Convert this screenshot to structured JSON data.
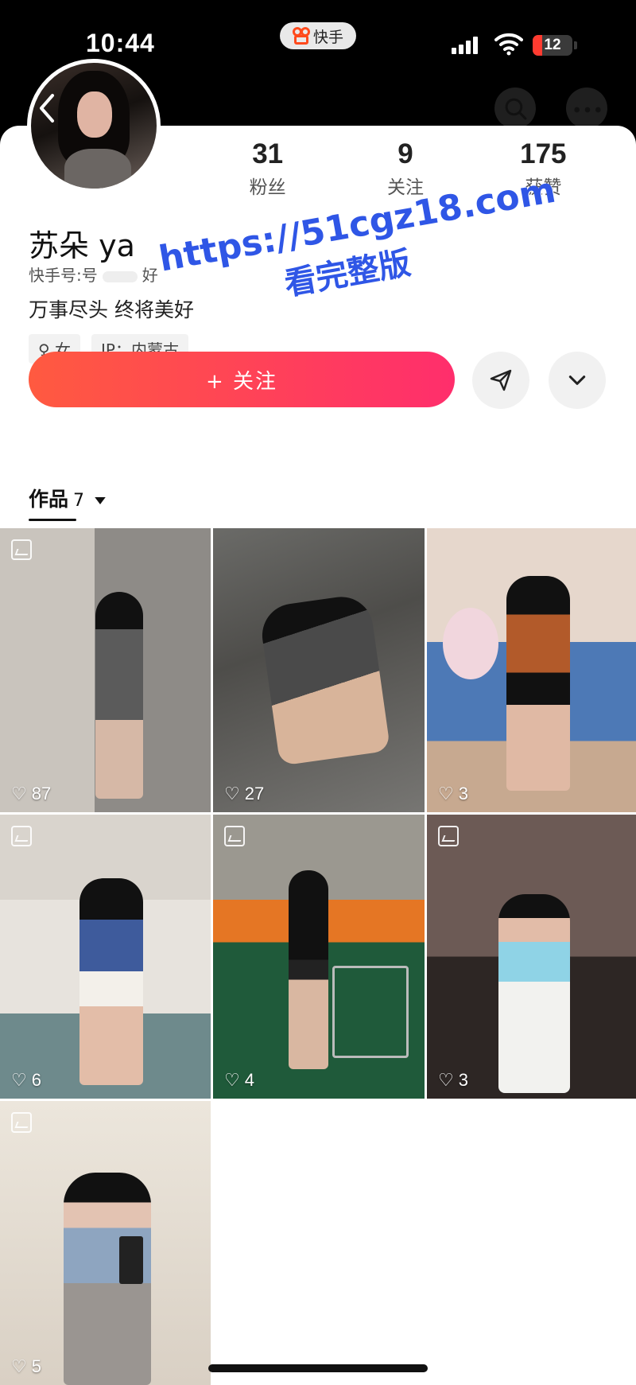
{
  "status_bar": {
    "time": "10:44",
    "app_name": "快手",
    "battery": "12"
  },
  "profile": {
    "name": "苏朵 ya",
    "id_label": "快手号:号",
    "id_suffix": "好",
    "bio": "万事尽头 终将美好",
    "tags": [
      "♀ 女",
      "IP：内蒙古"
    ],
    "stats": [
      {
        "value": "31",
        "label": "粉丝"
      },
      {
        "value": "9",
        "label": "关注"
      },
      {
        "value": "175",
        "label": "获赞"
      }
    ],
    "follow_label": "+ 关注"
  },
  "tabs": {
    "works_label": "作品",
    "works_count": "7"
  },
  "posts": [
    {
      "likes": "87"
    },
    {
      "likes": "27"
    },
    {
      "likes": "3"
    },
    {
      "likes": "6"
    },
    {
      "likes": "4"
    },
    {
      "likes": "3"
    },
    {
      "likes": "5"
    }
  ],
  "watermark": {
    "line1": "https://51cgz18.com",
    "line2": "看完整版"
  },
  "colors": {
    "follow_gradient_start": "#ff5a40",
    "follow_gradient_end": "#ff2e6c",
    "watermark": "#2f56e6"
  }
}
